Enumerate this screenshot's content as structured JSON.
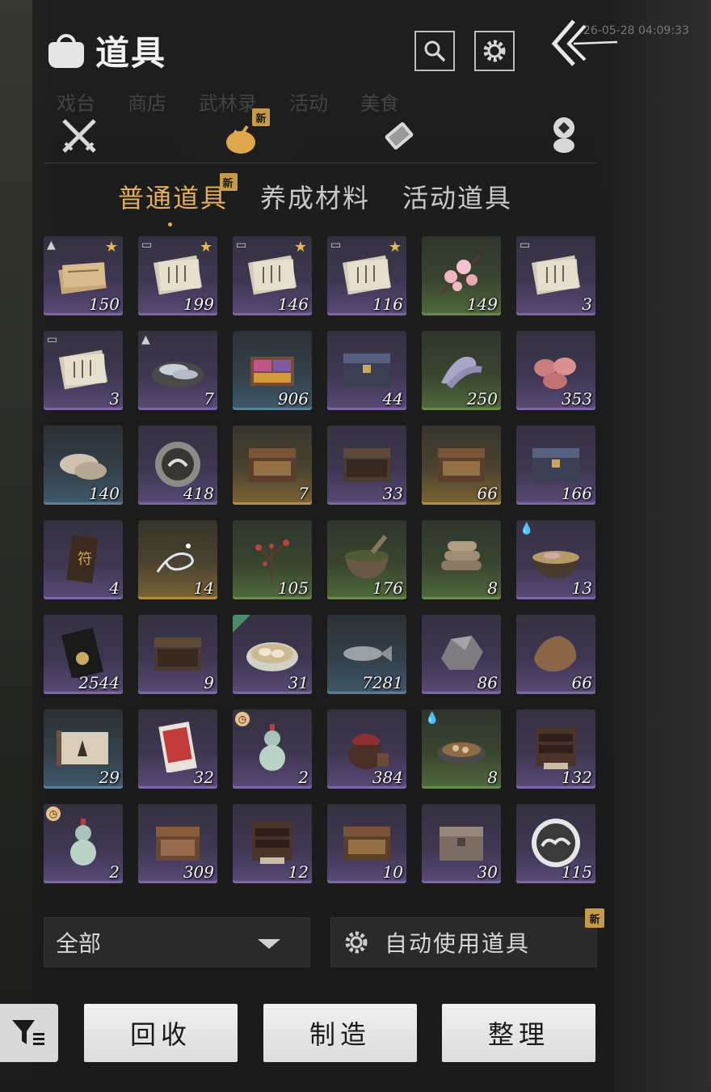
{
  "header": {
    "title": "道具",
    "timestamp": "26-05-28 04:09:33",
    "search_icon": "search-icon",
    "settings_icon": "gear-icon",
    "back_icon": "back-arrow-icon"
  },
  "background_tabs": [
    "戏台",
    "商店",
    "武林录",
    "活动",
    "美食"
  ],
  "categories": [
    {
      "icon": "crossed-swords-icon",
      "active": false,
      "badge": ""
    },
    {
      "icon": "pouch-icon",
      "active": true,
      "badge": "新"
    },
    {
      "icon": "scroll-icon",
      "active": false,
      "badge": ""
    },
    {
      "icon": "coins-icon",
      "active": false,
      "badge": ""
    }
  ],
  "subtabs": [
    {
      "label": "普通道具",
      "active": true,
      "badge": "新"
    },
    {
      "label": "养成材料",
      "active": false,
      "badge": ""
    },
    {
      "label": "活动道具",
      "active": false,
      "badge": ""
    }
  ],
  "items": [
    {
      "qty": "150",
      "rarity": "purple",
      "art": "paper-stack",
      "star": true,
      "mark": "rank"
    },
    {
      "qty": "199",
      "rarity": "purple",
      "art": "paper",
      "star": true,
      "mark": "scroll"
    },
    {
      "qty": "146",
      "rarity": "purple",
      "art": "paper",
      "star": true,
      "mark": "scroll"
    },
    {
      "qty": "116",
      "rarity": "purple",
      "art": "paper",
      "star": true,
      "mark": "scroll"
    },
    {
      "qty": "149",
      "rarity": "green",
      "art": "blossom",
      "star": false,
      "mark": ""
    },
    {
      "qty": "3",
      "rarity": "purple",
      "art": "paper",
      "star": false,
      "mark": "scroll"
    },
    {
      "qty": "3",
      "rarity": "purple",
      "art": "paper",
      "star": false,
      "mark": "scroll"
    },
    {
      "qty": "7",
      "rarity": "purple",
      "art": "fish-plate",
      "star": false,
      "mark": "rank"
    },
    {
      "qty": "906",
      "rarity": "blue",
      "art": "dye-box",
      "star": false,
      "mark": ""
    },
    {
      "qty": "44",
      "rarity": "purple",
      "art": "chest-blue",
      "star": false,
      "mark": ""
    },
    {
      "qty": "250",
      "rarity": "green",
      "art": "silk",
      "star": false,
      "mark": ""
    },
    {
      "qty": "353",
      "rarity": "purple",
      "art": "meat",
      "star": false,
      "mark": ""
    },
    {
      "qty": "140",
      "rarity": "blue",
      "art": "oyster",
      "star": false,
      "mark": ""
    },
    {
      "qty": "418",
      "rarity": "purple",
      "art": "medal",
      "star": false,
      "mark": ""
    },
    {
      "qty": "7",
      "rarity": "gold",
      "art": "chest-gold",
      "star": false,
      "mark": ""
    },
    {
      "qty": "33",
      "rarity": "purple",
      "art": "chest-brown",
      "star": false,
      "mark": ""
    },
    {
      "qty": "66",
      "rarity": "gold",
      "art": "chest-gold",
      "star": false,
      "mark": ""
    },
    {
      "qty": "166",
      "rarity": "purple",
      "art": "chest-blue",
      "star": false,
      "mark": ""
    },
    {
      "qty": "4",
      "rarity": "purple",
      "art": "talisman",
      "star": false,
      "mark": ""
    },
    {
      "qty": "14",
      "rarity": "gold",
      "art": "wisp",
      "star": false,
      "mark": ""
    },
    {
      "qty": "105",
      "rarity": "green",
      "art": "plum-branch",
      "star": false,
      "mark": ""
    },
    {
      "qty": "176",
      "rarity": "green",
      "art": "mortar",
      "star": false,
      "mark": ""
    },
    {
      "qty": "8",
      "rarity": "green",
      "art": "logs",
      "star": false,
      "mark": ""
    },
    {
      "qty": "13",
      "rarity": "purple",
      "art": "soup",
      "star": false,
      "mark": "drops"
    },
    {
      "qty": "2544",
      "rarity": "purple",
      "art": "card-black",
      "star": false,
      "mark": ""
    },
    {
      "qty": "9",
      "rarity": "purple",
      "art": "chest-brown",
      "star": false,
      "mark": ""
    },
    {
      "qty": "31",
      "rarity": "purple",
      "art": "dumplings",
      "star": false,
      "mark": "house"
    },
    {
      "qty": "7281",
      "rarity": "blue",
      "art": "fish",
      "star": false,
      "mark": ""
    },
    {
      "qty": "86",
      "rarity": "purple",
      "art": "ore",
      "star": false,
      "mark": ""
    },
    {
      "qty": "66",
      "rarity": "purple",
      "art": "hide",
      "star": false,
      "mark": ""
    },
    {
      "qty": "29",
      "rarity": "blue",
      "art": "painting",
      "star": false,
      "mark": ""
    },
    {
      "qty": "32",
      "rarity": "purple",
      "art": "card-red",
      "star": false,
      "mark": ""
    },
    {
      "qty": "2",
      "rarity": "purple",
      "art": "gourd",
      "star": false,
      "mark": "clock"
    },
    {
      "qty": "384",
      "rarity": "purple",
      "art": "jar",
      "star": false,
      "mark": ""
    },
    {
      "qty": "8",
      "rarity": "green",
      "art": "mushroom-dish",
      "star": false,
      "mark": "drops"
    },
    {
      "qty": "132",
      "rarity": "purple",
      "art": "cabinet",
      "star": false,
      "mark": ""
    },
    {
      "qty": "2",
      "rarity": "purple",
      "art": "gourd",
      "star": false,
      "mark": "clock"
    },
    {
      "qty": "309",
      "rarity": "purple",
      "art": "chest-carved",
      "star": false,
      "mark": ""
    },
    {
      "qty": "12",
      "rarity": "purple",
      "art": "cabinet",
      "star": false,
      "mark": ""
    },
    {
      "qty": "10",
      "rarity": "purple",
      "art": "chest-gold",
      "star": false,
      "mark": ""
    },
    {
      "qty": "30",
      "rarity": "purple",
      "art": "chest-grey",
      "star": false,
      "mark": ""
    },
    {
      "qty": "115",
      "rarity": "purple",
      "art": "cloud-coin",
      "star": false,
      "mark": ""
    }
  ],
  "filter": {
    "selected": "全部"
  },
  "auto_use": {
    "label": "自动使用道具",
    "badge": "新"
  },
  "buttons": {
    "recycle": "回收",
    "craft": "制造",
    "sort": "整理"
  },
  "colors": {
    "accent_gold": "#e2ae58",
    "rarity_purple": "#7c66a8",
    "rarity_green": "#6a8a4d",
    "rarity_gold": "#b48d3e",
    "rarity_blue": "#5d7f95"
  }
}
